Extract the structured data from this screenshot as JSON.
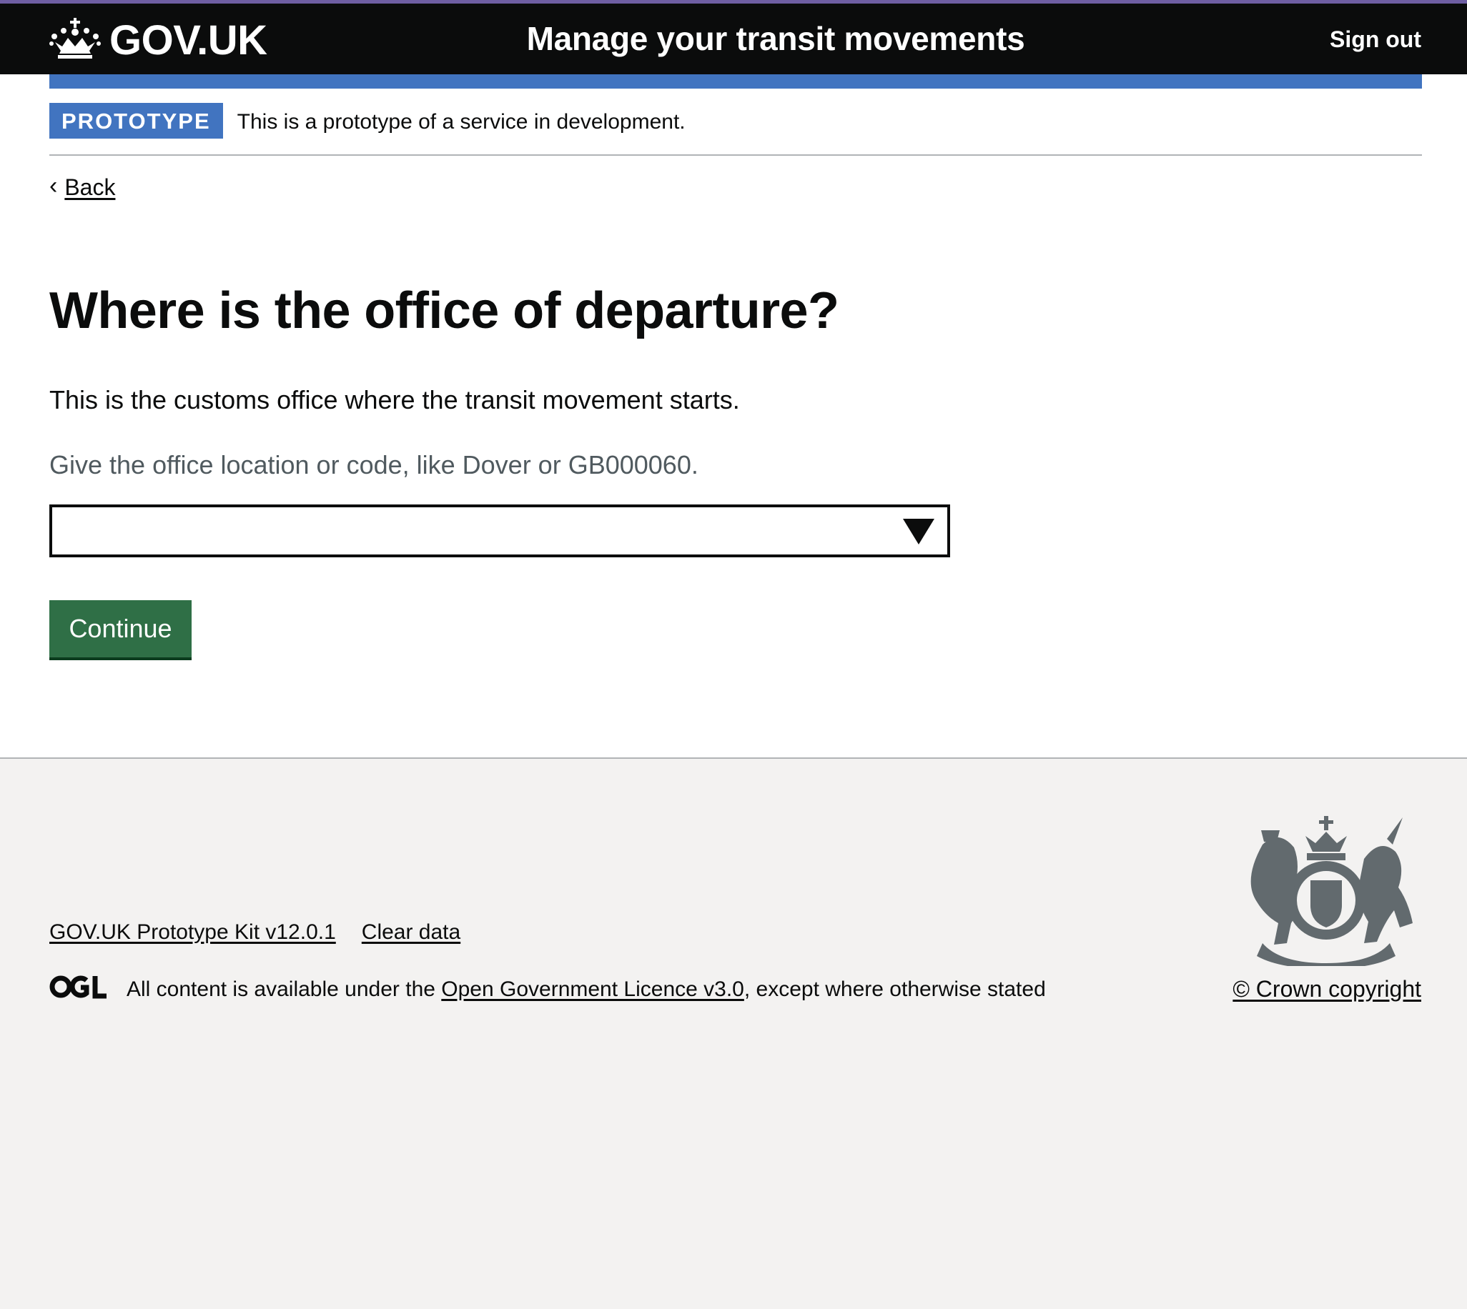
{
  "header": {
    "logo_text": "GOV.UK",
    "service_name": "Manage your transit movements",
    "sign_out_label": "Sign out"
  },
  "phase_banner": {
    "tag": "PROTOTYPE",
    "text": "This is a prototype of a service in development."
  },
  "back_link": {
    "label": "Back"
  },
  "main": {
    "heading": "Where is the office of departure?",
    "description": "This is the customs office where the transit movement starts.",
    "hint": "Give the office location or code, like Dover or GB000060.",
    "select_value": "",
    "continue_label": "Continue"
  },
  "footer": {
    "links": [
      "GOV.UK Prototype Kit v12.0.1",
      "Clear data"
    ],
    "licence_prefix": "All content is available under the ",
    "licence_link": "Open Government Licence v3.0",
    "licence_suffix": ", except where otherwise stated",
    "copyright": "© Crown copyright"
  },
  "colors": {
    "header_bg": "#0b0c0c",
    "header_top_border": "#6f5fa3",
    "brand_blue": "#4174c0",
    "button_green": "#2f6f46",
    "footer_bg": "#f3f2f1",
    "hint_grey": "#505a5f"
  },
  "icons": [
    "crown-icon",
    "chevron-left-icon",
    "dropdown-arrow-icon",
    "ogl-logo-icon",
    "royal-coat-of-arms-icon"
  ]
}
